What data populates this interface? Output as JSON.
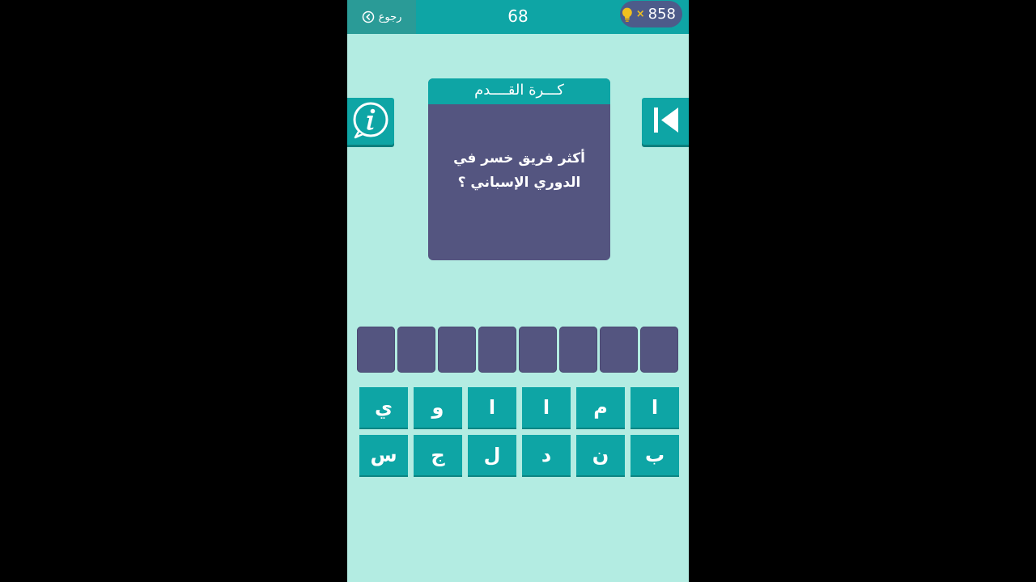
{
  "topbar": {
    "back_label": "رجوع",
    "level": "68",
    "coins": "858",
    "coins_times": "×"
  },
  "card": {
    "category": "كـــرة القــــدم",
    "question": "أكثر فريق خسر في الدوري الإسباني ؟"
  },
  "answer_slots": [
    "",
    "",
    "",
    "",
    "",
    "",
    "",
    ""
  ],
  "letters": [
    "ي",
    "و",
    "ا",
    "ا",
    "م",
    "ا",
    "س",
    "ج",
    "ل",
    "د",
    "ن",
    "ب"
  ],
  "colors": {
    "background": "#b3ece2",
    "teal": "#0ea5a5",
    "purple": "#545580",
    "bulb": "#f2c01e"
  },
  "icons": {
    "back": "chevron-left-circle-icon",
    "hint": "lightbulb-icon",
    "info": "info-icon",
    "skip": "skip-back-icon"
  }
}
